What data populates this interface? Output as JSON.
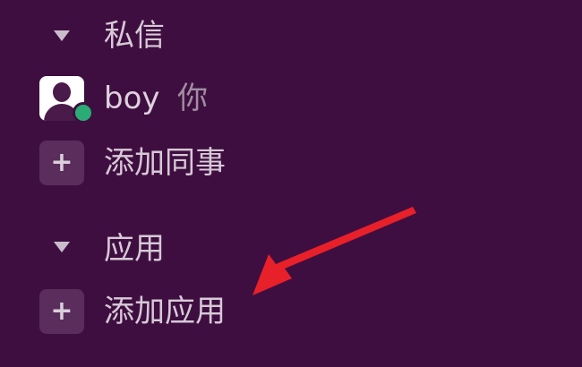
{
  "sidebar": {
    "dm_section": {
      "label": "私信",
      "caret_icon": "caret-down-icon"
    },
    "dm_items": [
      {
        "name": "boy",
        "you_suffix": "你",
        "avatar_icon": "user-avatar-icon",
        "presence": "online",
        "presence_color": "#2bac76"
      }
    ],
    "add_coworker": {
      "label": "添加同事",
      "icon": "plus-icon"
    },
    "apps_section": {
      "label": "应用",
      "caret_icon": "caret-down-icon"
    },
    "add_app": {
      "label": "添加应用",
      "icon": "plus-icon"
    }
  },
  "colors": {
    "background": "#3f0e40",
    "annotation_arrow": "#e8202a"
  }
}
